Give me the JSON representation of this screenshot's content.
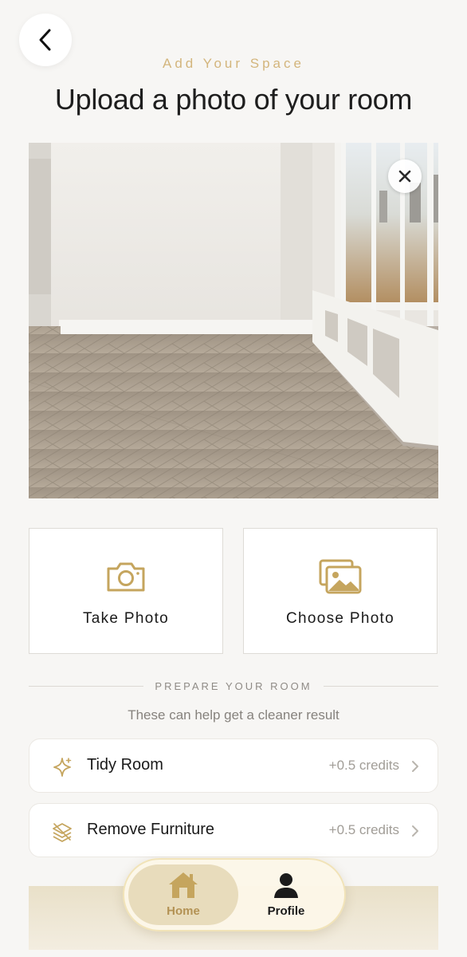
{
  "header": {
    "eyebrow": "Add Your Space",
    "title": "Upload a photo of your room"
  },
  "photo": {
    "icon": "room-photo",
    "remove_icon": "close-icon"
  },
  "actions": [
    {
      "label": "Take Photo",
      "icon": "camera-icon"
    },
    {
      "label": "Choose Photo",
      "icon": "gallery-icon"
    }
  ],
  "prepare": {
    "heading": "PREPARE YOUR ROOM",
    "subtext": "These can help get a cleaner result",
    "options": [
      {
        "label": "Tidy Room",
        "credits": "+0.5 credits",
        "icon": "sparkle-icon"
      },
      {
        "label": "Remove Furniture",
        "credits": "+0.5 credits",
        "icon": "layers-icon"
      }
    ]
  },
  "tabbar": {
    "items": [
      {
        "label": "Home",
        "icon": "home-icon",
        "active": true
      },
      {
        "label": "Profile",
        "icon": "profile-icon",
        "active": false
      }
    ]
  },
  "colors": {
    "accent": "#c5a55e",
    "background": "#f7f6f4",
    "tab_active_bg": "#e8dcbc"
  }
}
